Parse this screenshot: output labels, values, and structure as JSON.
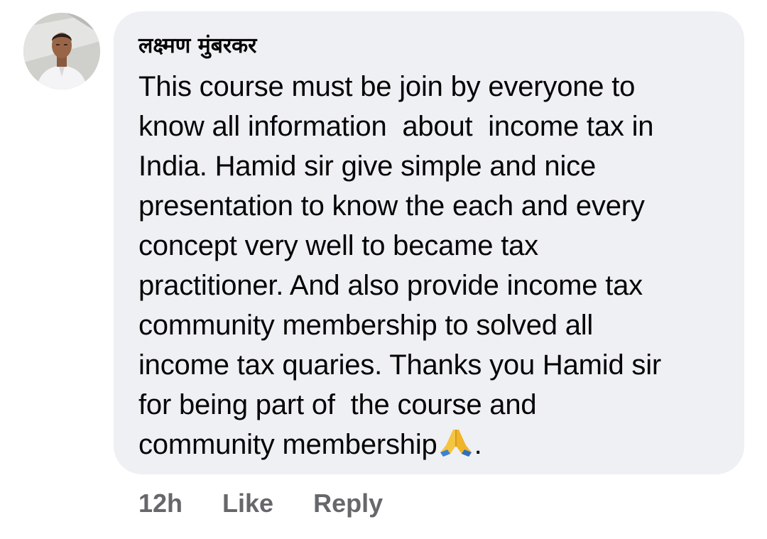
{
  "comment": {
    "author": "लक्ष्मण मुंबरकर",
    "avatar_icon": "profile-photo-avatar",
    "text_lines": [
      "This course must be join by everyone to",
      "know all information  about  income tax in",
      "India. Hamid sir give simple and nice",
      "presentation to know the each and every",
      "concept very well to became tax",
      "practitioner. And also provide income tax",
      "community membership to solved all",
      "income tax quaries. Thanks you Hamid sir",
      "for being part of  the course and",
      "community membership"
    ],
    "emoji": "folded-hands-emoji",
    "trailing_punct": ".",
    "bubble_color": "#eff0f4",
    "text_color": "#050505"
  },
  "actions": {
    "time": "12h",
    "like_label": "Like",
    "reply_label": "Reply",
    "color": "#65676b"
  }
}
